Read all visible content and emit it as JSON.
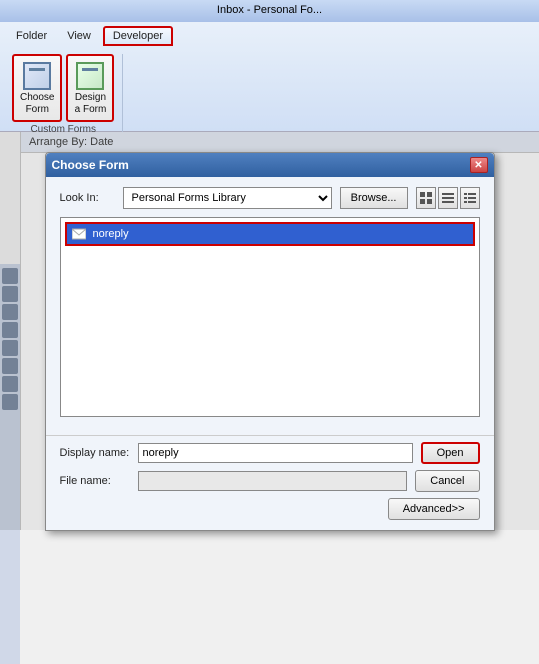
{
  "titlebar": {
    "text": "Inbox - Personal Fo..."
  },
  "ribbon": {
    "tabs": [
      {
        "label": "Folder",
        "active": false
      },
      {
        "label": "View",
        "active": false
      },
      {
        "label": "Developer",
        "active": true
      }
    ],
    "groups": [
      {
        "name": "Custom Forms",
        "buttons": [
          {
            "label": "Choose\nForm",
            "highlighted": true
          },
          {
            "label": "Design\na Form",
            "highlighted": false
          }
        ]
      }
    ]
  },
  "dialog": {
    "title": "Choose Form",
    "close_label": "✕",
    "look_in_label": "Look In:",
    "look_in_value": "Personal Forms Library",
    "browse_label": "Browse...",
    "forms_list": [
      {
        "label": "noreply",
        "selected": true
      }
    ],
    "display_name_label": "Display name:",
    "display_name_value": "noreply",
    "file_name_label": "File name:",
    "file_name_value": "",
    "open_label": "Open",
    "cancel_label": "Cancel",
    "advanced_label": "Advanced>>"
  },
  "email_list": {
    "header": "Arrange By: Date",
    "items": []
  }
}
